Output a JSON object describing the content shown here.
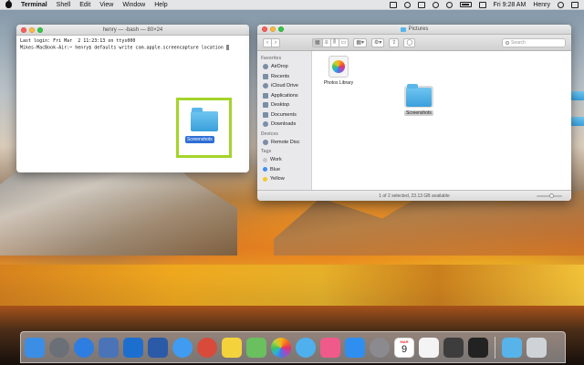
{
  "menubar": {
    "app_name": "Terminal",
    "menus": [
      "Shell",
      "Edit",
      "View",
      "Window",
      "Help"
    ],
    "clock": "Fri 9:28 AM",
    "user": "Henry"
  },
  "terminal": {
    "title": "henry — -bash — 80×24",
    "lines": [
      "Last login: Fri Mar  2 11:23:13 on ttys000",
      "Mikes-MacBook-Air:~ henry$ defaults write com.apple.screencapture location "
    ]
  },
  "drag": {
    "label": "Screenshots"
  },
  "finder": {
    "title": "Pictures",
    "search_placeholder": "Search",
    "sidebar": {
      "favorites_heading": "Favorites",
      "favorites": [
        "AirDrop",
        "Recents",
        "iCloud Drive",
        "Applications",
        "Desktop",
        "Documents",
        "Downloads"
      ],
      "devices_heading": "Devices",
      "devices": [
        "Remote Disc"
      ],
      "tags_heading": "Tags",
      "tags": [
        {
          "label": "Work",
          "color": "#c7c7c7"
        },
        {
          "label": "Blue",
          "color": "#3f8cf2"
        },
        {
          "label": "Yellow",
          "color": "#f5c92b"
        }
      ]
    },
    "files": [
      {
        "label": "Photos Library",
        "icon": "photos-library-icon"
      },
      {
        "label": "Screenshots",
        "icon": "folder-icon"
      }
    ],
    "status": "1 of 2 selected, 23.13 GB available"
  },
  "dock": {
    "calendar": {
      "month": "MAR",
      "day": "9"
    },
    "apps": [
      {
        "name": "finder-icon",
        "color": "#3b8ee6"
      },
      {
        "name": "launchpad-icon",
        "color": "#6b6f78"
      },
      {
        "name": "safari-compass-icon",
        "color": "#2e7de0"
      },
      {
        "name": "preview-icon",
        "color": "#4a74b7"
      },
      {
        "name": "outlook-icon",
        "color": "#1d6fcf"
      },
      {
        "name": "word-icon",
        "color": "#2b5aa8"
      },
      {
        "name": "safari-icon",
        "color": "#3f9cf0"
      },
      {
        "name": "app-red-icon",
        "color": "#d84a3a"
      },
      {
        "name": "notes-icon",
        "color": "#f4d23c"
      },
      {
        "name": "maps-icon",
        "color": "#6abf5e"
      },
      {
        "name": "photos-icon",
        "color": "#f1f1f1"
      },
      {
        "name": "messages-icon",
        "color": "#4fb0ee"
      },
      {
        "name": "itunes-icon",
        "color": "#f05a8a"
      },
      {
        "name": "app-store-icon",
        "color": "#2f8ff0"
      },
      {
        "name": "system-preferences-icon",
        "color": "#8a8a8f"
      },
      {
        "name": "calendar-icon",
        "color": "#ffffff"
      },
      {
        "name": "reminders-icon",
        "color": "#f4f4f4"
      },
      {
        "name": "chess-icon",
        "color": "#3d3d3d"
      },
      {
        "name": "terminal-icon",
        "color": "#222222"
      },
      {
        "name": "downloads-folder-icon",
        "color": "#58b3ea"
      },
      {
        "name": "trash-icon",
        "color": "#cfd3d8"
      }
    ]
  }
}
